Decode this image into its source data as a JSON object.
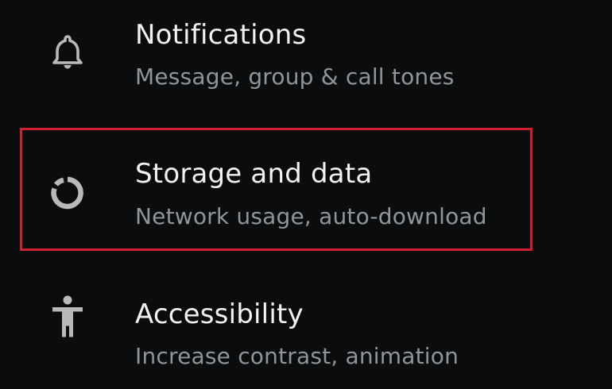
{
  "settings": {
    "items": [
      {
        "title": "Notifications",
        "subtitle": "Message, group & call tones",
        "icon": "bell-icon"
      },
      {
        "title": "Storage and data",
        "subtitle": "Network usage, auto-download",
        "icon": "storage-ring-icon"
      },
      {
        "title": "Accessibility",
        "subtitle": "Increase contrast, animation",
        "icon": "accessibility-person-icon"
      }
    ]
  },
  "colors": {
    "background": "#0b0c0d",
    "title_text": "#f3f3f3",
    "subtitle_text": "#8f969a",
    "icon_gray": "#b7b9bb",
    "highlight_red": "#d21f2f"
  }
}
